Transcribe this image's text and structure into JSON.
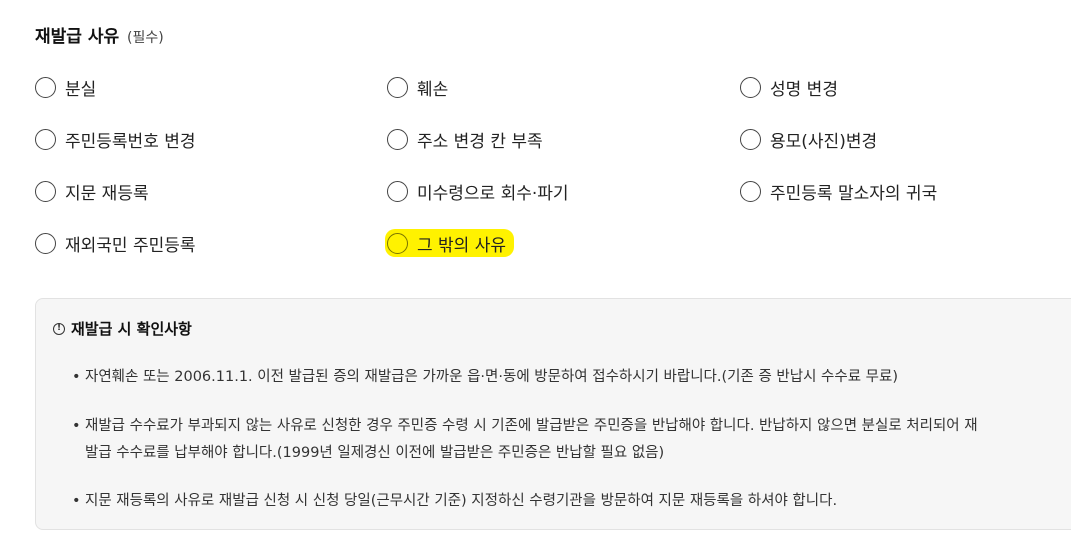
{
  "section": {
    "title": "재발급 사유",
    "required": "(필수)"
  },
  "options": [
    {
      "label": "분실"
    },
    {
      "label": "훼손"
    },
    {
      "label": "성명 변경"
    },
    {
      "label": "주민등록번호 변경"
    },
    {
      "label": "주소 변경 칸 부족"
    },
    {
      "label": "용모(사진)변경"
    },
    {
      "label": "지문 재등록"
    },
    {
      "label": "미수령으로 회수·파기"
    },
    {
      "label": "주민등록 말소자의 귀국"
    },
    {
      "label": "재외국민 주민등록"
    },
    {
      "label": "그 밖의 사유",
      "highlighted": true
    }
  ],
  "notice": {
    "icon": "info-icon",
    "title": "재발급 시 확인사항",
    "bullet_glyph": "•",
    "items": [
      {
        "lines": [
          "자연훼손 또는 2006.11.1. 이전 발급된 증의 재발급은 가까운 읍·면·동에 방문하여 접수하시기 바랍니다.(기존 증 반납시 수수료 무료)"
        ]
      },
      {
        "lines": [
          "재발급 수수료가 부과되지 않는 사유로 신청한 경우 주민증 수령 시 기존에 발급받은 주민증을 반납해야 합니다. 반납하지 않으면 분실로 처리되어 재",
          "발급 수수료를 납부해야 합니다.(1999년 일제경신 이전에 발급받은 주민증은 반납할 필요 없음)"
        ]
      },
      {
        "lines": [
          "지문 재등록의 사유로 재발급 신청 시 신청 당일(근무시간 기준) 지정하신 수령기관을 방문하여 지문 재등록을 하셔야 합니다."
        ]
      }
    ]
  },
  "colors": {
    "highlight": "#fff200",
    "notice_bg": "#f6f6f6"
  }
}
